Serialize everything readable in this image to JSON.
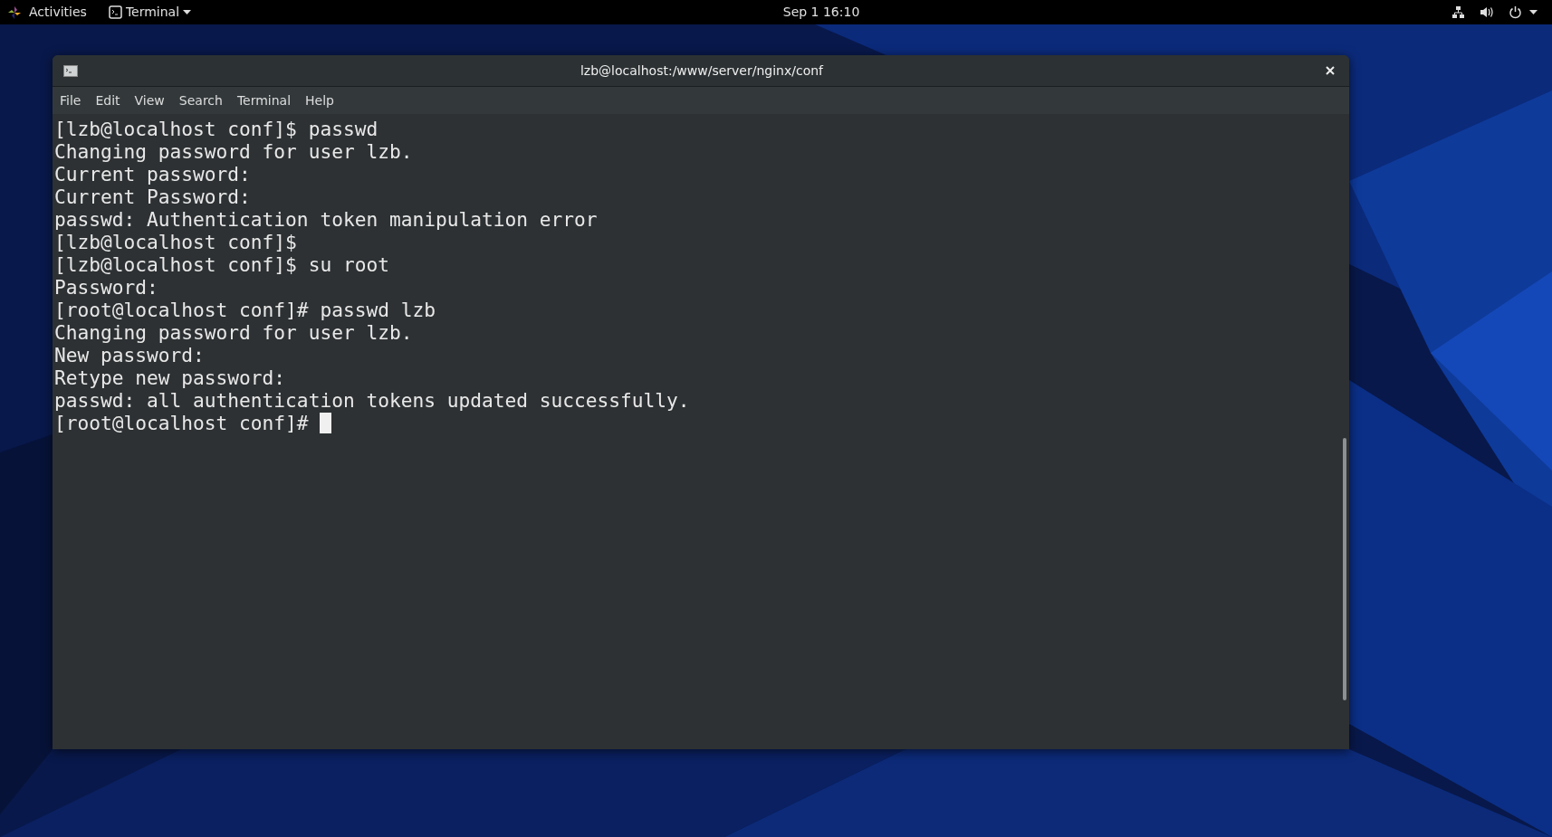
{
  "top_bar": {
    "activities": "Activities",
    "app_menu": "Terminal",
    "clock": "Sep 1  16:10"
  },
  "window": {
    "title": "lzb@localhost:/www/server/nginx/conf"
  },
  "menu": [
    "File",
    "Edit",
    "View",
    "Search",
    "Terminal",
    "Help"
  ],
  "terminal": {
    "lines": [
      "[lzb@localhost conf]$ passwd",
      "Changing password for user lzb.",
      "Current password:",
      "Current Password:",
      "passwd: Authentication token manipulation error",
      "[lzb@localhost conf]$",
      "[lzb@localhost conf]$ su root",
      "Password:",
      "[root@localhost conf]# passwd lzb",
      "Changing password for user lzb.",
      "New password:",
      "Retype new password:",
      "passwd: all authentication tokens updated successfully.",
      "[root@localhost conf]# "
    ]
  }
}
